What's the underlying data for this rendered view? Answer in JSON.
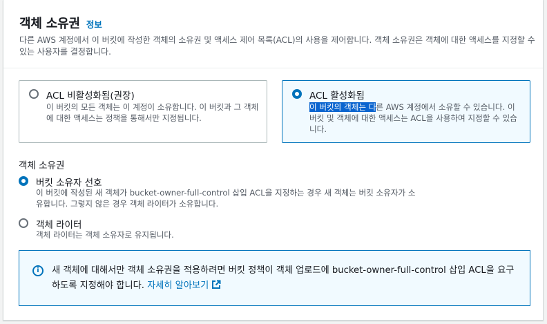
{
  "header": {
    "title": "객체 소유권",
    "info_link": "정보",
    "description": "다른 AWS 계정에서 이 버킷에 작성한 객체의 소유권 및 액세스 제어 목록(ACL)의 사용을 제어합니다. 객체 소유권은 객체에 대한 액세스를 지정할 수 있는 사용자를 결정합니다."
  },
  "acl_options": [
    {
      "label": "ACL 비활성화됨(권장)",
      "selected": false,
      "description": "이 버킷의 모든 객체는 이 계정이 소유합니다. 이 버킷과 그 객체에 대한 액세스는 정책을 통해서만 지정됩니다."
    },
    {
      "label": "ACL 활성화됨",
      "selected": true,
      "description_highlight": "이 버킷의 객체는 다",
      "description_rest": "른 AWS 계정에서 소유할 수 있습니다. 이 버킷 및 객체에 대한 액세스는 ACL을 사용하여 지정할 수 있습니다."
    }
  ],
  "object_ownership": {
    "section_label": "객체 소유권",
    "options": [
      {
        "label": "버킷 소유자 선호",
        "selected": true,
        "description": "이 버킷에 작성된 새 객체가 bucket-owner-full-control 삽입 ACL을 지정하는 경우 새 객체는 버킷 소유자가 소유합니다. 그렇지 않은 경우 객체 라이터가 소유합니다."
      },
      {
        "label": "객체 라이터",
        "selected": false,
        "description": "객체 라이터는 객체 소유자로 유지됩니다."
      }
    ]
  },
  "alert": {
    "icon": "info-icon",
    "text": "새 객체에 대해서만 객체 소유권을 적용하려면 버킷 정책이 객체 업로드에 bucket-owner-full-control 삽입 ACL을 요구하도록 지정해야 합니다. ",
    "link": "자세히 알아보기",
    "link_icon": "external-link-icon"
  },
  "colors": {
    "accent": "#0073bb",
    "selected_card_bg": "#f1faff",
    "text_primary": "#16191f",
    "text_secondary": "#545b64",
    "selection_highlight": "#0a64cf"
  }
}
